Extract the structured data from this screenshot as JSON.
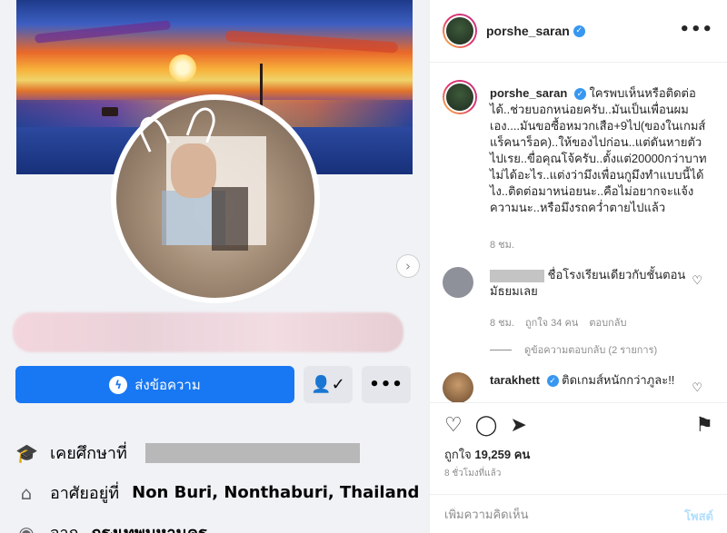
{
  "facebook": {
    "message_button": "ส่งข้อความ",
    "friend_icon": "person-check-icon",
    "more_icon": "more-icon",
    "education_prefix": "เคยศึกษาที่",
    "lives_prefix": "อาศัยอยู่ที่",
    "lives_place": "Non Buri, Nonthaburi, Thailand",
    "from_prefix": "จาก",
    "from_place": "กรุงเทพมหานคร"
  },
  "instagram": {
    "username": "porshe_saran",
    "more_icon": "more-icon",
    "caption": "ใครพบเห็นหรือติดต่อได้..ช่วยบอกหน่อยครับ..มันเป็นเพื่อนผมเอง....มันขอซื้อหมวกเสือ+9ไป(ของในเกมส์แร็คนาร็อค)..ให้ของไปก่อน..แต่ดันหายตัวไปเรย..ขื่อคุณโจ้ครับ..ตั้งแต่20000กว่าบาทไม่ได้อะไร..แต่งว่ามึงเพื่อนกูมึงทำแบบนี้ได้ไง..ติดต่อมาหน่อยนะ..คือไม่อยากจะแจ้งความนะ..หรือมึงรถคว่ำตายไปแล้ว",
    "caption_time": "8 ชม.",
    "comments": [
      {
        "text": "ชื่อโรงเรียนเดียวกับชั้นตอนมัธยมเลย",
        "time": "8 ชม.",
        "likes": "ถูกใจ 34 คน",
        "reply": "ตอบกลับ",
        "view_replies": "ดูข้อความตอบกลับ (2 รายการ)"
      },
      {
        "username": "tarakhett",
        "text": "ติดเกมส์หนักกว่าภูละ!!"
      }
    ],
    "likes_label": "ถูกใจ",
    "likes_count": "19,259",
    "likes_suffix": "คน",
    "posted_ago": "8 ชั่วโมงที่แล้ว",
    "add_comment_placeholder": "เพิ่มความคิดเห็น",
    "post_button": "โพสต์"
  }
}
